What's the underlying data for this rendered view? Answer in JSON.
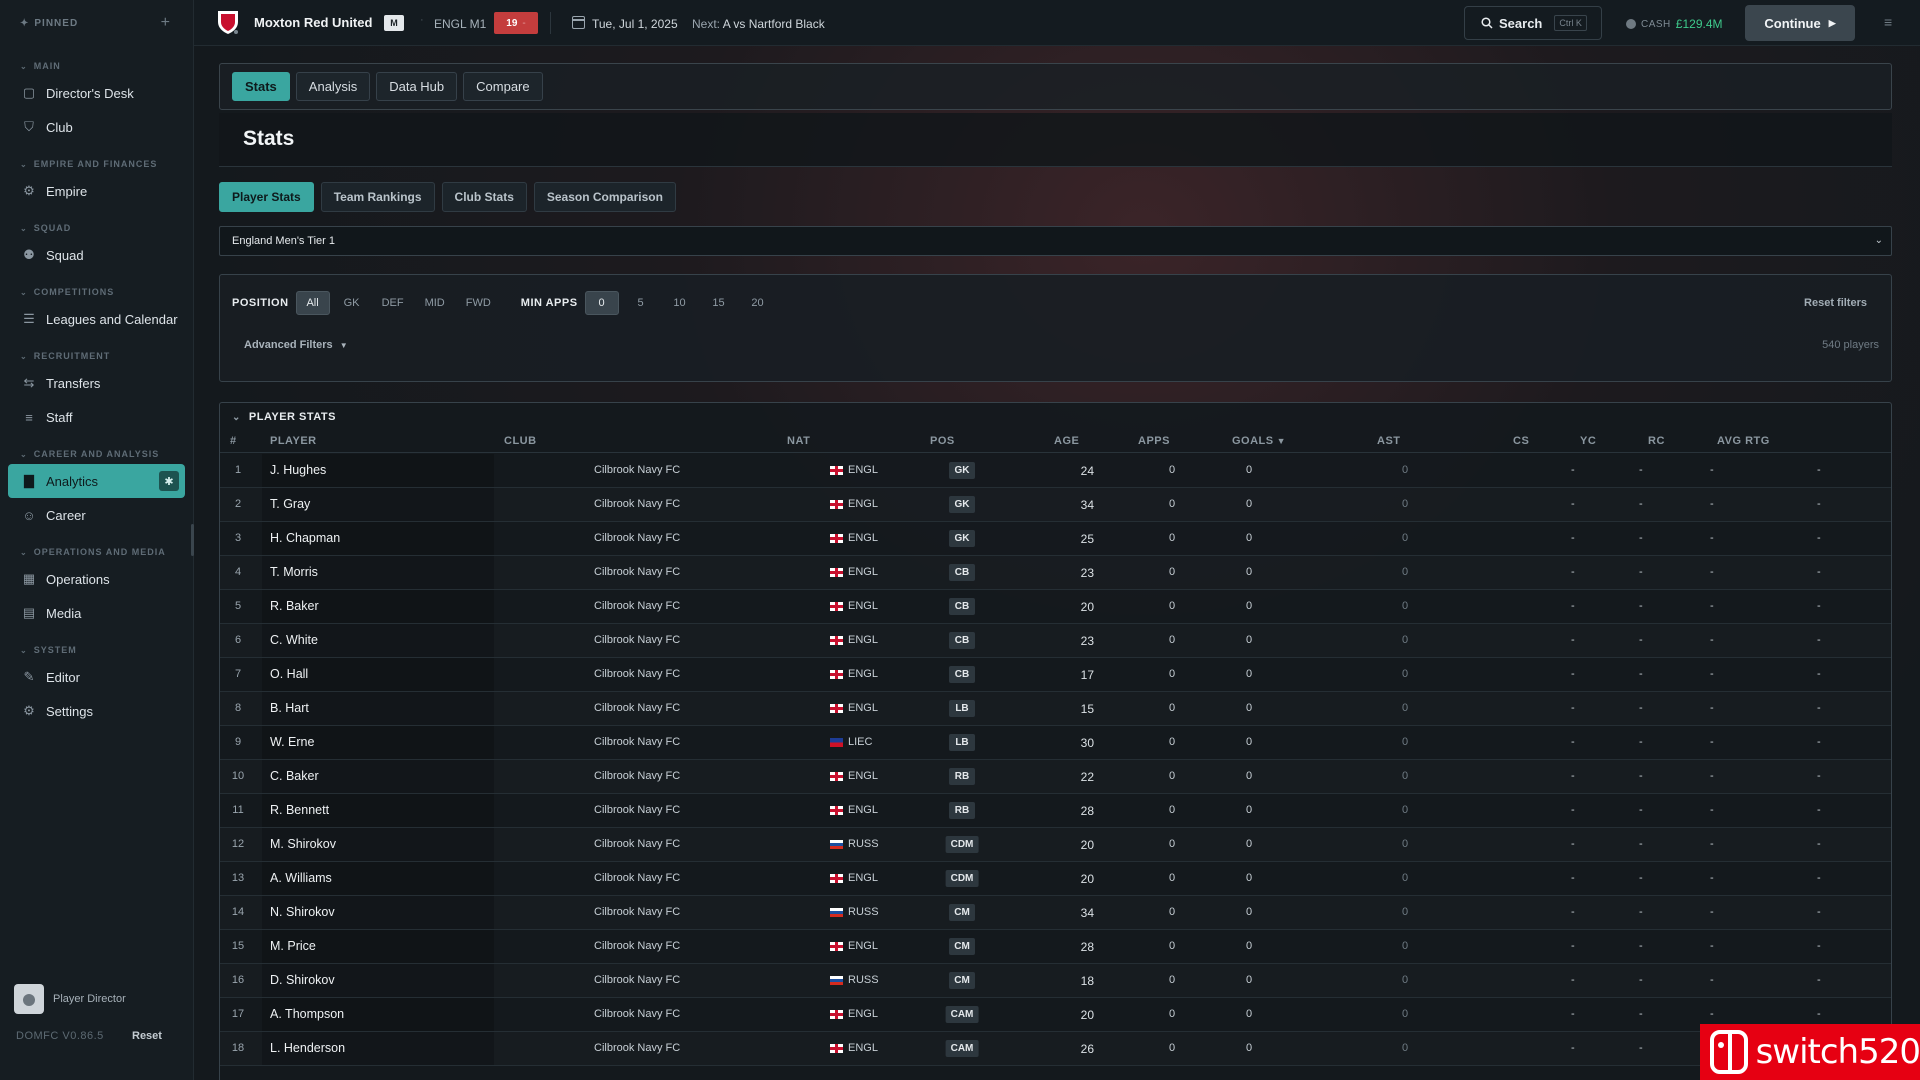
{
  "sidebar": {
    "pinned_label": "PINNED",
    "sections": [
      {
        "title": "MAIN",
        "items": [
          {
            "label": "Director's Desk",
            "icon": "clipboard-icon"
          },
          {
            "label": "Club",
            "icon": "shield-icon"
          }
        ]
      },
      {
        "title": "EMPIRE AND FINANCES",
        "items": [
          {
            "label": "Empire",
            "icon": "gear-icon"
          }
        ]
      },
      {
        "title": "SQUAD",
        "items": [
          {
            "label": "Squad",
            "icon": "people-icon"
          }
        ]
      },
      {
        "title": "COMPETITIONS",
        "items": [
          {
            "label": "Leagues and Calendar",
            "icon": "list-icon"
          }
        ]
      },
      {
        "title": "RECRUITMENT",
        "items": [
          {
            "label": "Transfers",
            "icon": "transfer-icon"
          },
          {
            "label": "Staff",
            "icon": "staff-icon"
          }
        ]
      },
      {
        "title": "CAREER AND ANALYSIS",
        "items": [
          {
            "label": "Analytics",
            "icon": "bar-chart-icon",
            "active": true
          },
          {
            "label": "Career",
            "icon": "person-icon"
          }
        ]
      },
      {
        "title": "OPERATIONS AND MEDIA",
        "items": [
          {
            "label": "Operations",
            "icon": "building-icon"
          },
          {
            "label": "Media",
            "icon": "newspaper-icon"
          }
        ]
      },
      {
        "title": "SYSTEM",
        "items": [
          {
            "label": "Editor",
            "icon": "pencil-icon"
          },
          {
            "label": "Settings",
            "icon": "gear-icon"
          }
        ]
      }
    ],
    "user_label": "Player Director",
    "version": "DOMFC V0.86.5",
    "reset_label": "Reset"
  },
  "topbar": {
    "club_name": "Moxton Red United",
    "badge": "M",
    "league": "ENGL M1",
    "rank": "19",
    "rank_suffix": "-",
    "date": "Tue, Jul 1, 2025",
    "next_prefix": "Next:",
    "next_match": "A  vs Nartford Black",
    "search_label": "Search",
    "search_shortcut": "Ctrl K",
    "cash_label": "CASH",
    "cash_value": "£129.4M",
    "continue_label": "Continue",
    "accent": "#3aa6a0"
  },
  "main": {
    "tabs": [
      "Stats",
      "Analysis",
      "Data Hub",
      "Compare"
    ],
    "page_title": "Stats",
    "subtabs": [
      "Player Stats",
      "Team Rankings",
      "Club Stats",
      "Season Comparison"
    ],
    "league_select": "England Men's Tier 1",
    "filters": {
      "position_label": "POSITION",
      "positions": [
        "All",
        "GK",
        "DEF",
        "MID",
        "FWD"
      ],
      "min_apps_label": "MIN APPS",
      "min_apps": [
        "0",
        "5",
        "10",
        "15",
        "20"
      ],
      "reset_label": "Reset filters",
      "advanced_label": "Advanced Filters",
      "players_count": "540 players"
    },
    "table": {
      "title": "PLAYER STATS",
      "columns": [
        "#",
        "PLAYER",
        "CLUB",
        "NAT",
        "POS",
        "AGE",
        "APPS",
        "GOALS",
        "AST",
        "CS",
        "YC",
        "RC",
        "AVG RTG"
      ],
      "sort_column": "GOALS",
      "rows": [
        {
          "n": "1",
          "player": "J. Hughes",
          "club": "Cilbrook Navy FC",
          "flag": "eng",
          "nat": "ENGL",
          "pos": "GK",
          "age": "24"
        },
        {
          "n": "2",
          "player": "T. Gray",
          "club": "Cilbrook Navy FC",
          "flag": "eng",
          "nat": "ENGL",
          "pos": "GK",
          "age": "34"
        },
        {
          "n": "3",
          "player": "H. Chapman",
          "club": "Cilbrook Navy FC",
          "flag": "eng",
          "nat": "ENGL",
          "pos": "GK",
          "age": "25"
        },
        {
          "n": "4",
          "player": "T. Morris",
          "club": "Cilbrook Navy FC",
          "flag": "eng",
          "nat": "ENGL",
          "pos": "CB",
          "age": "23"
        },
        {
          "n": "5",
          "player": "R. Baker",
          "club": "Cilbrook Navy FC",
          "flag": "eng",
          "nat": "ENGL",
          "pos": "CB",
          "age": "20"
        },
        {
          "n": "6",
          "player": "C. White",
          "club": "Cilbrook Navy FC",
          "flag": "eng",
          "nat": "ENGL",
          "pos": "CB",
          "age": "23"
        },
        {
          "n": "7",
          "player": "O. Hall",
          "club": "Cilbrook Navy FC",
          "flag": "eng",
          "nat": "ENGL",
          "pos": "CB",
          "age": "17"
        },
        {
          "n": "8",
          "player": "B. Hart",
          "club": "Cilbrook Navy FC",
          "flag": "eng",
          "nat": "ENGL",
          "pos": "LB",
          "age": "15"
        },
        {
          "n": "9",
          "player": "W. Erne",
          "club": "Cilbrook Navy FC",
          "flag": "lie",
          "nat": "LIEC",
          "pos": "LB",
          "age": "30"
        },
        {
          "n": "10",
          "player": "C. Baker",
          "club": "Cilbrook Navy FC",
          "flag": "eng",
          "nat": "ENGL",
          "pos": "RB",
          "age": "22"
        },
        {
          "n": "11",
          "player": "R. Bennett",
          "club": "Cilbrook Navy FC",
          "flag": "eng",
          "nat": "ENGL",
          "pos": "RB",
          "age": "28"
        },
        {
          "n": "12",
          "player": "M. Shirokov",
          "club": "Cilbrook Navy FC",
          "flag": "rus",
          "nat": "RUSS",
          "pos": "CDM",
          "age": "20"
        },
        {
          "n": "13",
          "player": "A. Williams",
          "club": "Cilbrook Navy FC",
          "flag": "eng",
          "nat": "ENGL",
          "pos": "CDM",
          "age": "20"
        },
        {
          "n": "14",
          "player": "N. Shirokov",
          "club": "Cilbrook Navy FC",
          "flag": "rus",
          "nat": "RUSS",
          "pos": "CM",
          "age": "34"
        },
        {
          "n": "15",
          "player": "M. Price",
          "club": "Cilbrook Navy FC",
          "flag": "eng",
          "nat": "ENGL",
          "pos": "CM",
          "age": "28"
        },
        {
          "n": "16",
          "player": "D. Shirokov",
          "club": "Cilbrook Navy FC",
          "flag": "rus",
          "nat": "RUSS",
          "pos": "CM",
          "age": "18"
        },
        {
          "n": "17",
          "player": "A. Thompson",
          "club": "Cilbrook Navy FC",
          "flag": "eng",
          "nat": "ENGL",
          "pos": "CAM",
          "age": "20"
        },
        {
          "n": "18",
          "player": "L. Henderson",
          "club": "Cilbrook Navy FC",
          "flag": "eng",
          "nat": "ENGL",
          "pos": "CAM",
          "age": "26"
        }
      ],
      "apps_value": "0",
      "goals_value": "0",
      "ast_value": "0",
      "empty_value": "-"
    }
  },
  "watermark": "switch520"
}
